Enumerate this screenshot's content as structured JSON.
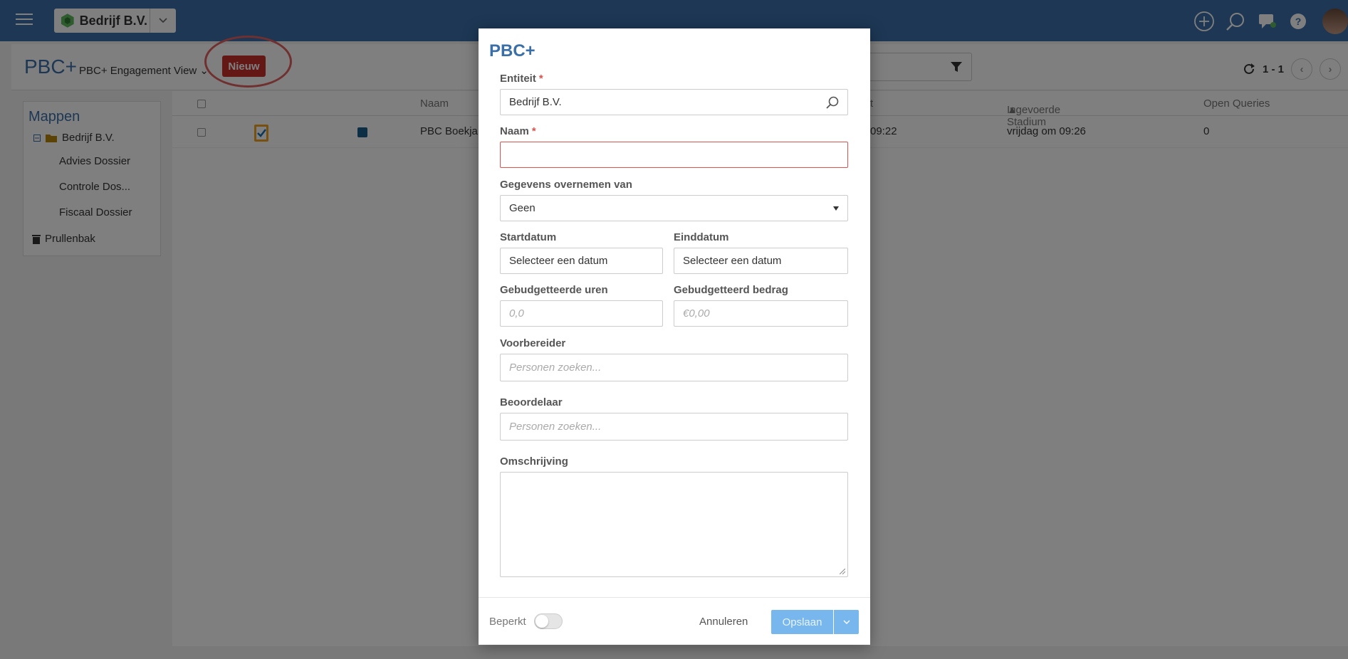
{
  "topbar": {
    "company": "Bedrijf B.V."
  },
  "subheader": {
    "app_title": "PBC+",
    "view": "PBC+ Engagement View",
    "new_button": "Nieuw",
    "pager": "1 - 1"
  },
  "sidebar": {
    "title": "Mappen",
    "root": "Bedrijf B.V.",
    "children": [
      "Advies Dossier",
      "Controle Dos...",
      "Fiscaal Dossier"
    ],
    "trash": "Prullenbak"
  },
  "grid": {
    "headers": {
      "name": "Naam",
      "partial": "t",
      "stage": "Ingevoerde Stadium",
      "queries": "Open Queries"
    },
    "row": {
      "name": "PBC Boekja",
      "time": "09:22",
      "stage": "vrijdag om 09:26",
      "queries": "0"
    }
  },
  "modal": {
    "title": "PBC+",
    "entity_label": "Entiteit",
    "entity_value": "Bedrijf B.V.",
    "name_label": "Naam",
    "name_value": "",
    "copy_label": "Gegevens overnemen van",
    "copy_value": "Geen",
    "start_label": "Startdatum",
    "start_value": "Selecteer een datum",
    "end_label": "Einddatum",
    "end_value": "Selecteer een datum",
    "hours_label": "Gebudgetteerde uren",
    "hours_placeholder": "0,0",
    "amount_label": "Gebudgetteerd bedrag",
    "amount_placeholder": "€0,00",
    "preparer_label": "Voorbereider",
    "preparer_placeholder": "Personen zoeken...",
    "reviewer_label": "Beoordelaar",
    "reviewer_placeholder": "Personen zoeken...",
    "description_label": "Omschrijving",
    "required_mark": "*"
  },
  "footer": {
    "restricted_label": "Beperkt",
    "cancel": "Annuleren",
    "save": "Opslaan"
  },
  "colors": {
    "brand": "#3a6fa8",
    "danger": "#d9534f",
    "primary_disabled": "#77b7ee"
  }
}
